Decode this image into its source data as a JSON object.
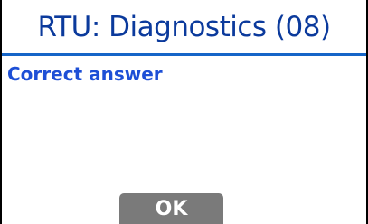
{
  "dialog": {
    "title": "RTU: Diagnostics (08)",
    "message": "Correct answer",
    "ok_label": "OK"
  },
  "colors": {
    "title": "#0b3a9c",
    "divider": "#1565c8",
    "message": "#1d4fd6",
    "button_bg": "#7a7a7a",
    "button_text": "#ffffff",
    "frame": "#000000"
  }
}
